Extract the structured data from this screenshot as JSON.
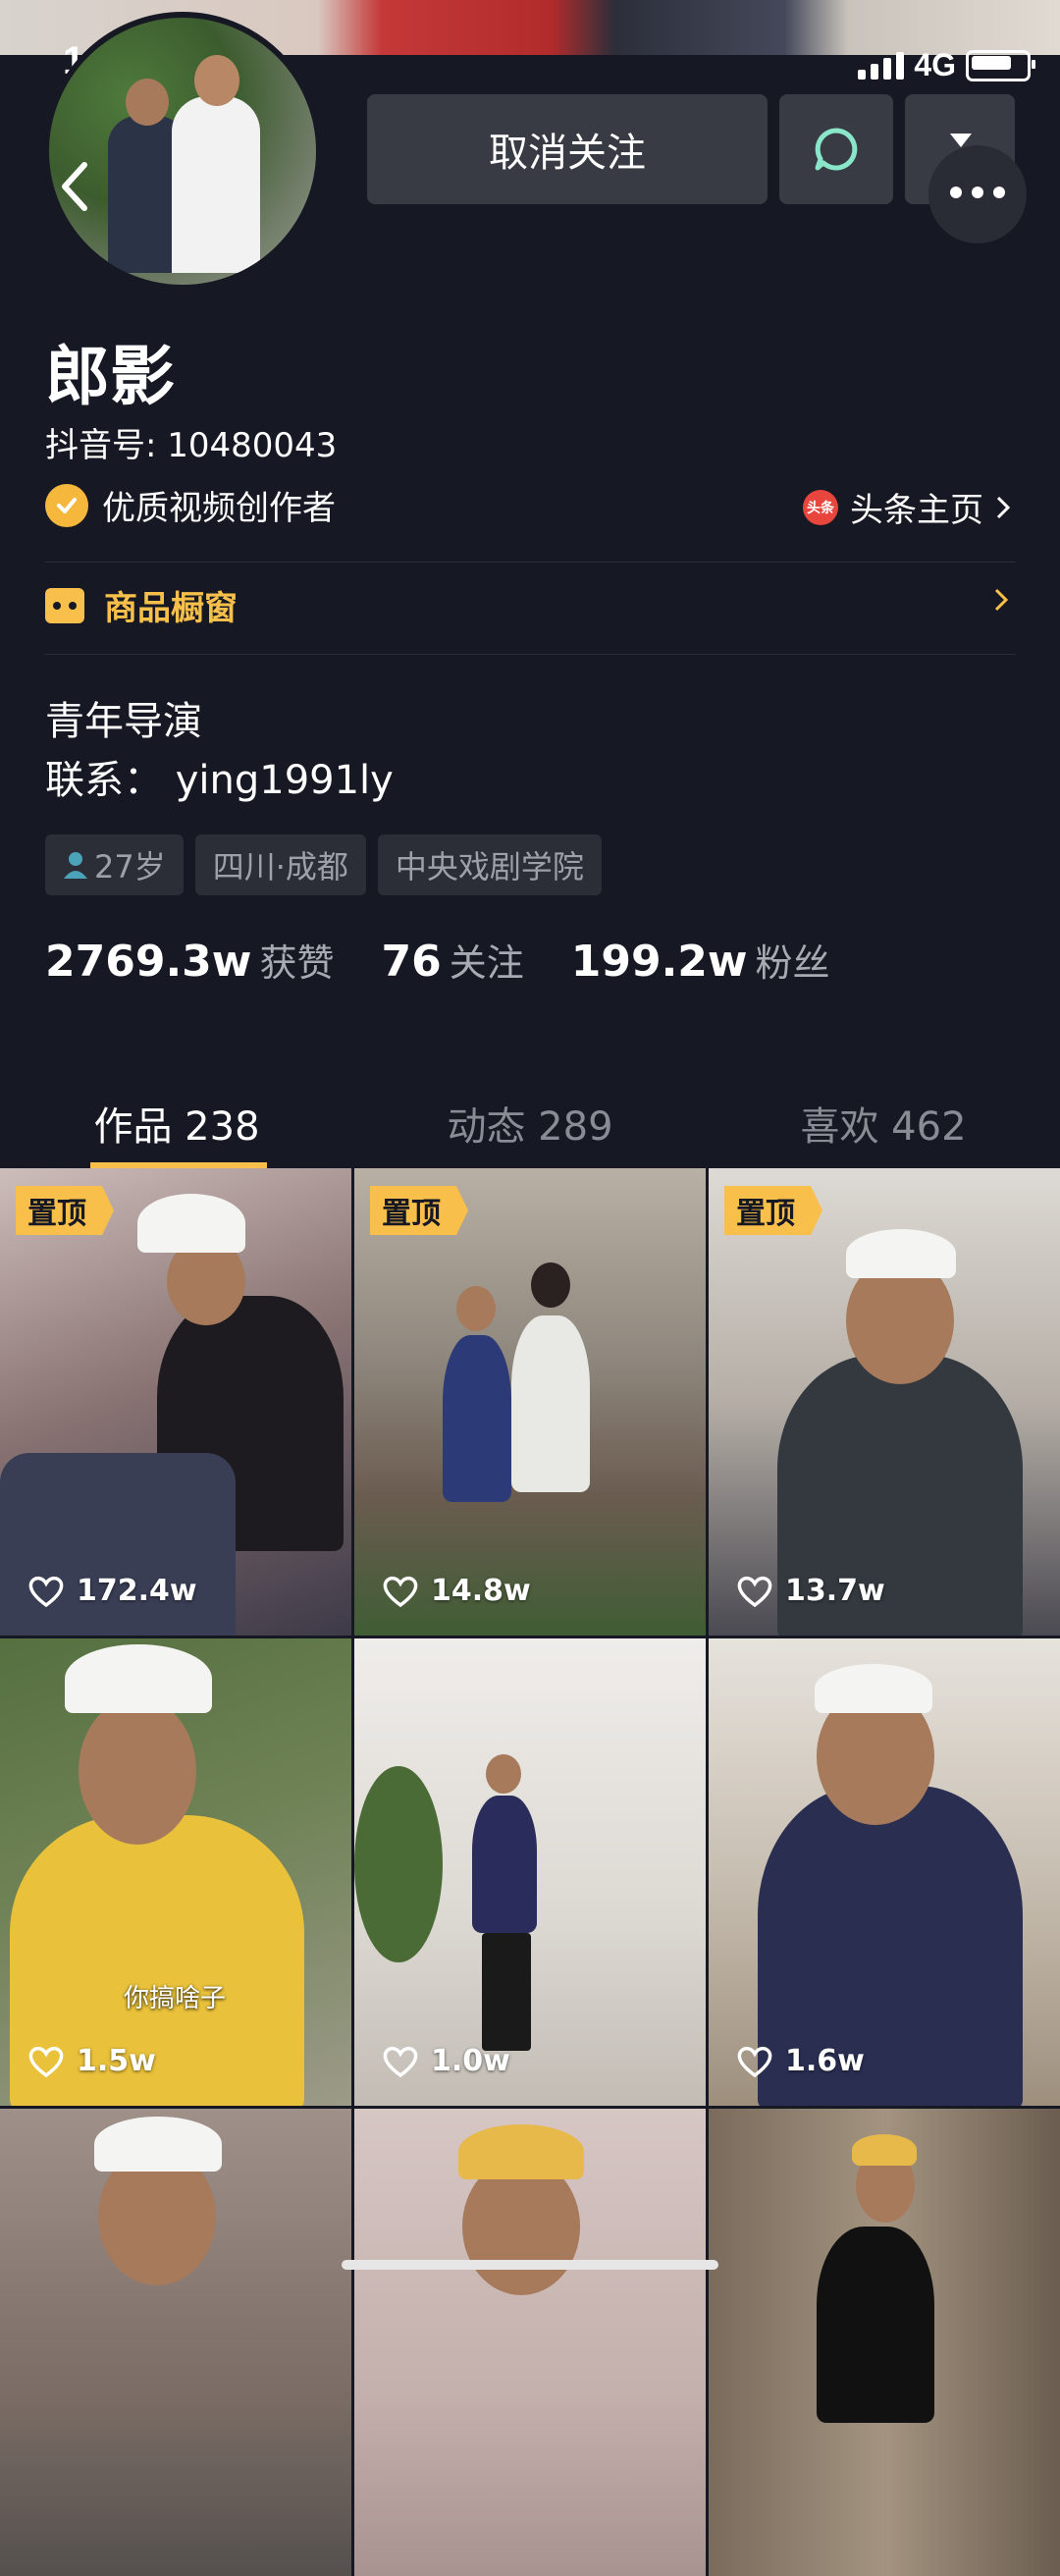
{
  "status": {
    "time": "11:31",
    "network": "4G"
  },
  "header": {
    "unfollow_label": "取消关注"
  },
  "profile": {
    "name": "郎影",
    "douyin_id": "抖音号: 10480043",
    "certification": "优质视频创作者",
    "toutiao_label": "头条主页",
    "toutiao_icon_text": "头条",
    "shop_label": "商品橱窗",
    "bio_line1": "青年导演",
    "bio_line2": "联系： ying1991ly",
    "tags": [
      "27岁",
      "四川·成都",
      "中央戏剧学院"
    ]
  },
  "stats": [
    {
      "value": "2769.3w",
      "label": "获赞"
    },
    {
      "value": "76",
      "label": "关注"
    },
    {
      "value": "199.2w",
      "label": "粉丝"
    }
  ],
  "tabs": [
    {
      "label": "作品 238",
      "active": true
    },
    {
      "label": "动态 289",
      "active": false
    },
    {
      "label": "喜欢 462",
      "active": false
    }
  ],
  "videos": [
    {
      "pinned": "置顶",
      "likes": "172.4w",
      "bg": "#6b5a5a"
    },
    {
      "pinned": "置顶",
      "likes": "14.8w",
      "bg": "#7a7266"
    },
    {
      "pinned": "置顶",
      "likes": "13.7w",
      "bg": "#8e8a86"
    },
    {
      "likes": "1.5w",
      "bg": "#5c7046",
      "caption": "你搞啥子"
    },
    {
      "likes": "1.0w",
      "bg": "#d8d4cf"
    },
    {
      "likes": "1.6w",
      "bg": "#b7a894"
    },
    {
      "bg": "#9b8f87"
    },
    {
      "bg": "#c9b9b4"
    },
    {
      "bg": "#7b6a5e"
    }
  ],
  "colors": {
    "accent": "#f8c04a",
    "background": "#161823",
    "button": "#393b44",
    "message_icon": "#8ae6c8"
  }
}
